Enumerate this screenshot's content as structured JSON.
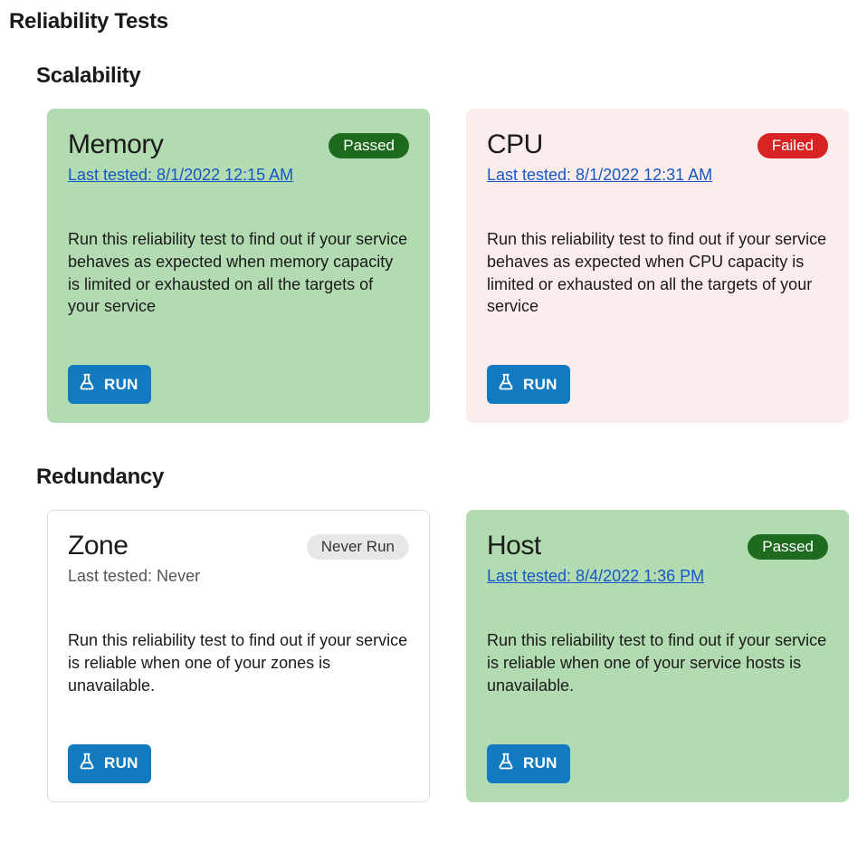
{
  "page_title": "Reliability Tests",
  "run_label": "RUN",
  "status_labels": {
    "passed": "Passed",
    "failed": "Failed",
    "never": "Never Run"
  },
  "sections": [
    {
      "title": "Scalability",
      "cards": [
        {
          "title": "Memory",
          "status": "passed",
          "last_tested": "Last tested: 8/1/2022 12:15 AM",
          "last_tested_link": true,
          "description": "Run this reliability test to find out if your service behaves as expected when memory capacity is limited or exhausted on all the targets of your service"
        },
        {
          "title": "CPU",
          "status": "failed",
          "last_tested": "Last tested: 8/1/2022 12:31 AM",
          "last_tested_link": true,
          "description": "Run this reliability test to find out if your service behaves as expected when CPU capacity is limited or exhausted on all the targets of your service"
        }
      ]
    },
    {
      "title": "Redundancy",
      "cards": [
        {
          "title": "Zone",
          "status": "never",
          "last_tested": "Last tested: Never",
          "last_tested_link": false,
          "description": "Run this reliability test to find out if your service is reliable when one of your zones is unavailable."
        },
        {
          "title": "Host",
          "status": "passed",
          "last_tested": "Last tested: 8/4/2022 1:36 PM",
          "last_tested_link": true,
          "description": "Run this reliability test to find out if your service is reliable when one of your service hosts is unavailable."
        }
      ]
    }
  ]
}
